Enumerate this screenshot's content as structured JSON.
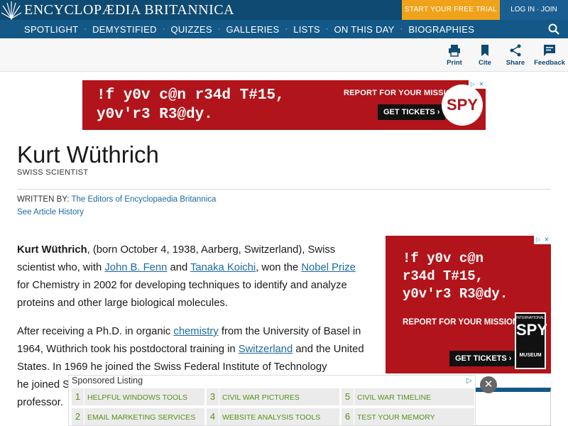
{
  "header": {
    "brand": "ENCYCLOPÆDIA BRITANNICA",
    "trial_button": "START YOUR FREE TRIAL",
    "login_button": "LOG IN · JOIN",
    "nav": [
      "SPOTLIGHT",
      "DEMYSTIFIED",
      "QUIZZES",
      "GALLERIES",
      "LISTS",
      "ON THIS DAY",
      "BIOGRAPHIES"
    ],
    "nav_separator": "·"
  },
  "tools": {
    "print": "Print",
    "cite": "Cite",
    "share": "Share",
    "feedback": "Feedback"
  },
  "ad_top": {
    "line1": "!f y0v c@n r34d T#15,",
    "line2": "y0v'r3 R3@dy.",
    "mission": "REPORT FOR YOUR MISSION",
    "tickets": "GET TICKETS ›",
    "logo": "SPY"
  },
  "article": {
    "title": "Kurt Wüthrich",
    "subtitle": "SWISS SCIENTIST",
    "written_by_label": "WRITTEN BY:",
    "written_by": "The Editors of Encyclopaedia Britannica",
    "history_link": "See Article History",
    "p1": {
      "bold": "Kurt Wüthrich",
      "t1": ", (born October 4, 1938, Aarberg, Switzerland), Swiss scientist who, with ",
      "l1": "John B. Fenn",
      "t2": " and ",
      "l2": "Tanaka Koichi",
      "t3": ", won the ",
      "l3": "Nobel Prize",
      "t4": " for Chemistry in 2002 for developing techniques to identify and analyze proteins and other large biological molecules."
    },
    "p2": {
      "t1": "After receiving a Ph.D. in organic ",
      "l1": "chemistry",
      "t2": " from the University of Basel in 1964, Wüthrich took his postdoctoral training in ",
      "l2": "Switzerland",
      "t3": " and the United States. In 1969 he joined the Swiss Federal Institute of Technology",
      "t4": "he joined S",
      "t5": "professor."
    }
  },
  "ad_side": {
    "line1": "!f y0v c@n",
    "line2": "r34d T#15,",
    "line3": "y0v'r3 R3@dy.",
    "mission": "REPORT FOR YOUR MISSION",
    "tickets": "GET TICKETS ›",
    "museum_top": "INTERNATIONAL",
    "museum_logo": "SPY",
    "museum_bottom": "MUSEUM"
  },
  "sponsored": {
    "heading": "Sponsored Listing",
    "items": [
      {
        "num": "1",
        "label": "HELPFUL WINDOWS TOOLS"
      },
      {
        "num": "3",
        "label": "CIVIL WAR PICTURES"
      },
      {
        "num": "5",
        "label": "CIVIL WAR TIMELINE"
      },
      {
        "num": "2",
        "label": "EMAIL MARKETING SERVICES"
      },
      {
        "num": "4",
        "label": "WEBSITE ANALYSIS TOOLS"
      },
      {
        "num": "6",
        "label": "TEST YOUR MEMORY"
      }
    ],
    "close": "✕"
  },
  "colors": {
    "topbar": "#0e4a72",
    "nav": "#145887",
    "trial": "#f0a31a",
    "link": "#1b6aa3",
    "ad_red": "#b1141a"
  }
}
